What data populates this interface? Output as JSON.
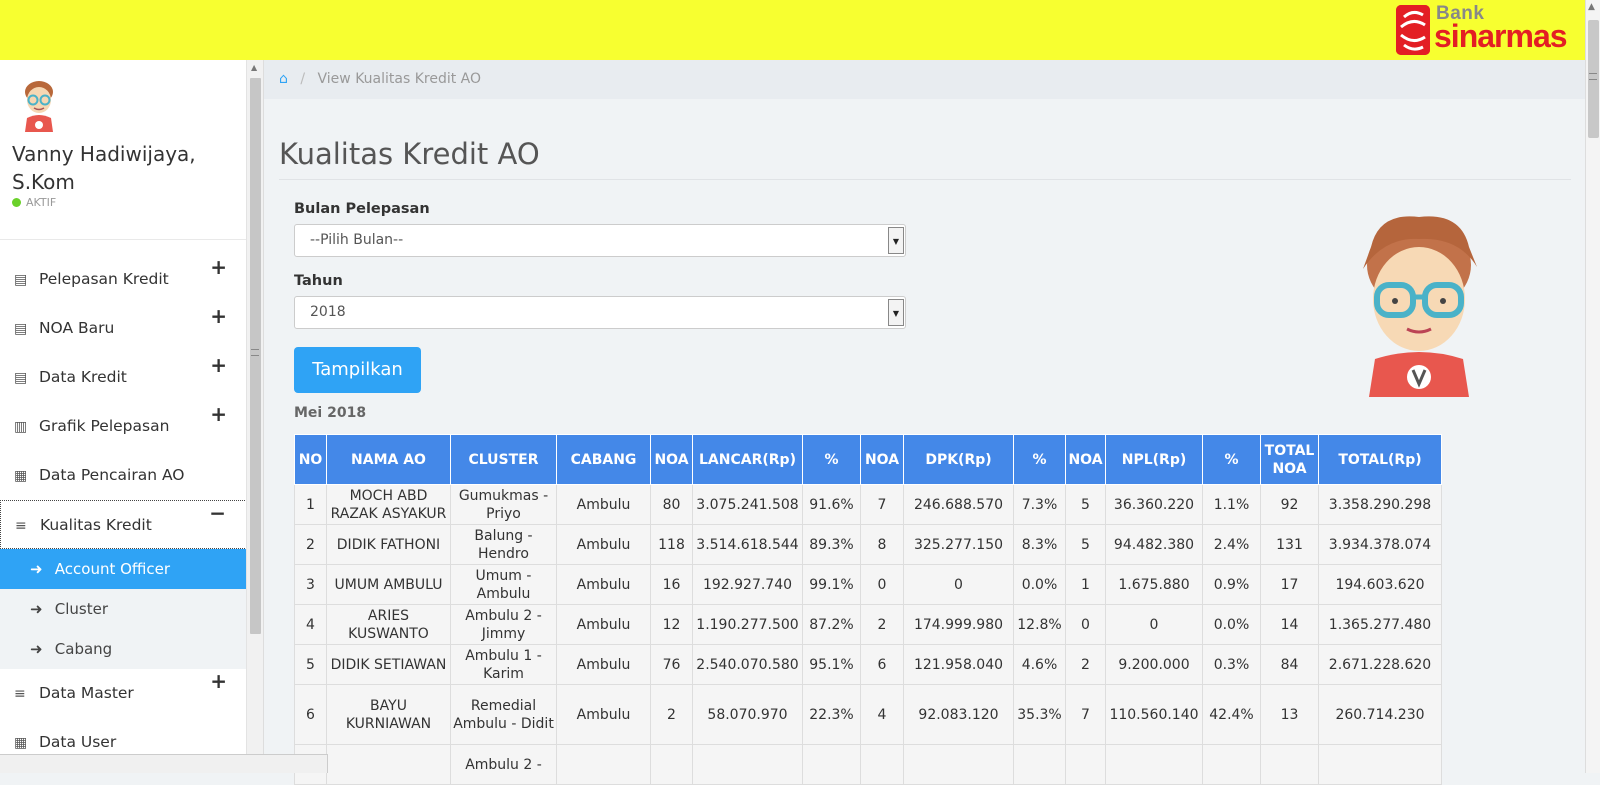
{
  "brand": {
    "top_word": "Bank",
    "name": "sinarmas",
    "accent": "#e31e24",
    "topbar_color": "#f7ff30"
  },
  "user": {
    "name": "Vanny Hadiwijaya, S.Kom",
    "status": "AKTIF"
  },
  "menu": {
    "items": [
      {
        "label": "Pelepasan Kredit",
        "icon": "money-icon"
      },
      {
        "label": "NOA Baru",
        "icon": "money-icon"
      },
      {
        "label": "Data Kredit",
        "icon": "money-icon"
      },
      {
        "label": "Grafik Pelepasan",
        "icon": "bar-chart-icon"
      },
      {
        "label": "Data Pencairan AO",
        "icon": "calendar-icon"
      },
      {
        "label": "Kualitas Kredit",
        "icon": "list-icon"
      }
    ],
    "sub": [
      {
        "label": "Account Officer",
        "active": true
      },
      {
        "label": "Cluster",
        "active": false
      },
      {
        "label": "Cabang",
        "active": false
      }
    ],
    "after": [
      {
        "label": "Data Master",
        "icon": "list-icon"
      },
      {
        "label": "Data User",
        "icon": "calendar-icon"
      }
    ]
  },
  "breadcrumb": {
    "current": "View Kualitas Kredit AO"
  },
  "page": {
    "title": "Kualitas Kredit AO"
  },
  "form": {
    "month_label": "Bulan Pelepasan",
    "month_value": "--Pilih Bulan--",
    "year_label": "Tahun",
    "year_value": "2018",
    "submit": "Tampilkan"
  },
  "period": "Mei  2018",
  "table": {
    "headers": [
      "NO",
      "NAMA AO",
      "CLUSTER",
      "CABANG",
      "NOA",
      "LANCAR(Rp)",
      "%",
      "NOA",
      "DPK(Rp)",
      "%",
      "NOA",
      "NPL(Rp)",
      "%",
      "TOTAL NOA",
      "TOTAL(Rp)"
    ],
    "rows": [
      [
        "1",
        "MOCH ABD RAZAK ASYAKUR",
        "Gumukmas - Priyo",
        "Ambulu",
        "80",
        "3.075.241.508",
        "91.6%",
        "7",
        "246.688.570",
        "7.3%",
        "5",
        "36.360.220",
        "1.1%",
        "92",
        "3.358.290.298"
      ],
      [
        "2",
        "DIDIK FATHONI",
        "Balung - Hendro",
        "Ambulu",
        "118",
        "3.514.618.544",
        "89.3%",
        "8",
        "325.277.150",
        "8.3%",
        "5",
        "94.482.380",
        "2.4%",
        "131",
        "3.934.378.074"
      ],
      [
        "3",
        "UMUM AMBULU",
        "Umum - Ambulu",
        "Ambulu",
        "16",
        "192.927.740",
        "99.1%",
        "0",
        "0",
        "0.0%",
        "1",
        "1.675.880",
        "0.9%",
        "17",
        "194.603.620"
      ],
      [
        "4",
        "ARIES KUSWANTO",
        "Ambulu 2 - Jimmy",
        "Ambulu",
        "12",
        "1.190.277.500",
        "87.2%",
        "2",
        "174.999.980",
        "12.8%",
        "0",
        "0",
        "0.0%",
        "14",
        "1.365.277.480"
      ],
      [
        "5",
        "DIDIK SETIAWAN",
        "Ambulu 1 - Karim",
        "Ambulu",
        "76",
        "2.540.070.580",
        "95.1%",
        "6",
        "121.958.040",
        "4.6%",
        "2",
        "9.200.000",
        "0.3%",
        "84",
        "2.671.228.620"
      ],
      [
        "6",
        "BAYU KURNIAWAN",
        "Remedial Ambulu - Didit",
        "Ambulu",
        "2",
        "58.070.970",
        "22.3%",
        "4",
        "92.083.120",
        "35.3%",
        "7",
        "110.560.140",
        "42.4%",
        "13",
        "260.714.230"
      ],
      [
        "",
        "",
        "Ambulu 2 -",
        "",
        "",
        "",
        "",
        "",
        "",
        "",
        "",
        "",
        "",
        "",
        ""
      ]
    ]
  }
}
